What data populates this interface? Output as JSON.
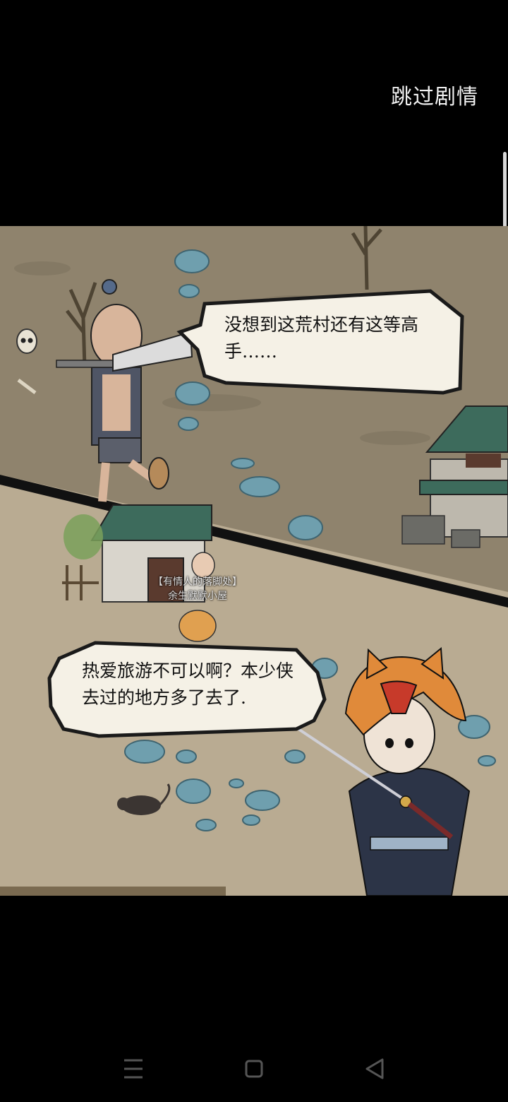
{
  "header": {
    "skip_label": "跳过剧情"
  },
  "dialogues": {
    "villager": {
      "line1": "没想到这荒村还有这等高",
      "line2": "手……"
    },
    "hero": {
      "line1": "热爱旅游不可以啊？本少侠",
      "line2": "去过的地方多了去了."
    }
  },
  "building_label": {
    "line1": "【有情人的落脚处】",
    "line2": "余生默默小屋"
  },
  "nav": {
    "menu_icon": "menu-icon",
    "home_icon": "home-icon",
    "back_icon": "back-icon"
  },
  "colors": {
    "upper_ground": "#8f836d",
    "lower_ground": "#b9ab92",
    "bubble_fill": "#f5f1e6",
    "bubble_border": "#1a1a1a",
    "rock": "#6f9fae",
    "roof": "#3d6b5c"
  }
}
